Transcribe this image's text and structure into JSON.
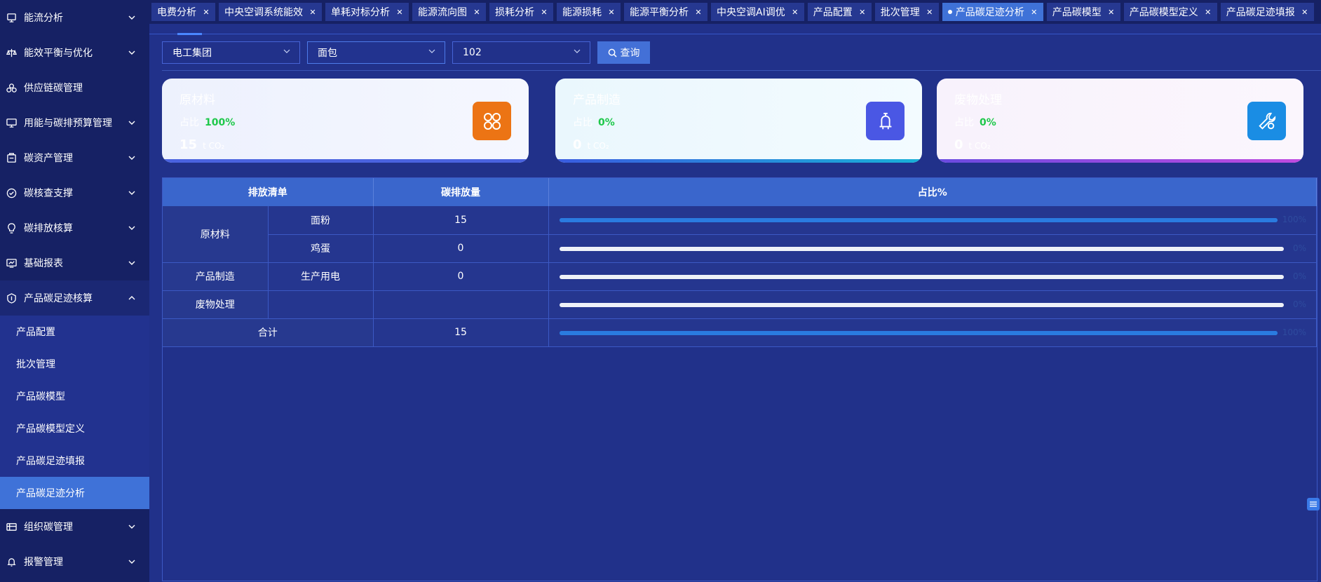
{
  "sidebar": {
    "items": [
      {
        "label": "能流分析",
        "icon": "flow-icon",
        "expandable": true
      },
      {
        "label": "能效平衡与优化",
        "icon": "balance-icon",
        "expandable": true
      },
      {
        "label": "供应链碳管理",
        "icon": "supply-chain-icon",
        "expandable": false
      },
      {
        "label": "用能与碳排预算管理",
        "icon": "monitor-icon",
        "expandable": true
      },
      {
        "label": "碳资产管理",
        "icon": "asset-icon",
        "expandable": true
      },
      {
        "label": "碳核查支撑",
        "icon": "verify-icon",
        "expandable": true
      },
      {
        "label": "碳排放核算",
        "icon": "bulb-icon",
        "expandable": true
      },
      {
        "label": "基础报表",
        "icon": "report-icon",
        "expandable": true
      },
      {
        "label": "产品碳足迹核算",
        "icon": "footprint-icon",
        "expandable": true,
        "open": true
      },
      {
        "label": "组织碳管理",
        "icon": "org-icon",
        "expandable": true
      },
      {
        "label": "报警管理",
        "icon": "alarm-icon",
        "expandable": true
      }
    ],
    "submenu": [
      {
        "label": "产品配置"
      },
      {
        "label": "批次管理"
      },
      {
        "label": "产品碳模型"
      },
      {
        "label": "产品碳模型定义"
      },
      {
        "label": "产品碳足迹填报"
      },
      {
        "label": "产品碳足迹分析",
        "active": true
      }
    ]
  },
  "tabs": [
    {
      "label": "电费分析"
    },
    {
      "label": "中央空调系统能效"
    },
    {
      "label": "单耗对标分析"
    },
    {
      "label": "能源流向图"
    },
    {
      "label": "损耗分析"
    },
    {
      "label": "能源损耗"
    },
    {
      "label": "能源平衡分析"
    },
    {
      "label": "中央空调AI调优"
    },
    {
      "label": "产品配置"
    },
    {
      "label": "批次管理"
    },
    {
      "label": "产品碳足迹分析",
      "active": true
    },
    {
      "label": "产品碳模型"
    },
    {
      "label": "产品碳模型定义"
    },
    {
      "label": "产品碳足迹填报"
    }
  ],
  "filters": {
    "company": "电工集团",
    "product": "面包",
    "batch": "102",
    "query_label": "查询"
  },
  "cards": [
    {
      "title": "原材料",
      "ratio_label": "占比",
      "ratio": "100%",
      "amount": "15",
      "unit": "t CO₂",
      "icon": "grid-icon"
    },
    {
      "title": "产品制造",
      "ratio_label": "占比",
      "ratio": "0%",
      "amount": "0",
      "unit": "t CO₂",
      "icon": "bell-icon"
    },
    {
      "title": "废物处理",
      "ratio_label": "占比",
      "ratio": "0%",
      "amount": "0",
      "unit": "t CO₂",
      "icon": "wrench-icon"
    }
  ],
  "table": {
    "headers": {
      "list": "排放清单",
      "emission": "碳排放量",
      "ratio": "占比%"
    },
    "groups": {
      "raw": "原材料",
      "manufacture": "产品制造",
      "waste": "废物处理",
      "total": "合计"
    },
    "rows": [
      {
        "item": "面粉",
        "emission": "15",
        "percent": 100,
        "percent_label": "100%"
      },
      {
        "item": "鸡蛋",
        "emission": "0",
        "percent": 0,
        "percent_label": "0%"
      },
      {
        "item": "生产用电",
        "emission": "0",
        "percent": 0,
        "percent_label": "0%"
      },
      {
        "item": "",
        "emission": "",
        "percent": 0,
        "percent_label": "0%"
      }
    ],
    "total": {
      "emission": "15",
      "percent": 100,
      "percent_label": "100%"
    }
  },
  "colors": {
    "accent": "#3f72d8",
    "ratio_green": "#1ec84a",
    "bar_blue": "#2a7be0"
  }
}
